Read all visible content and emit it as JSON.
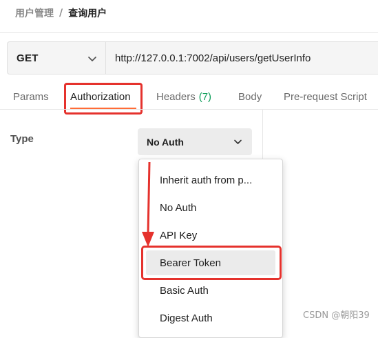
{
  "breadcrumb": {
    "parent": "用户管理",
    "separator": "/",
    "current": "查询用户"
  },
  "request": {
    "method": "GET",
    "url": "http://127.0.0.1:7002/api/users/getUserInfo"
  },
  "tabs": {
    "params": "Params",
    "authorization": "Authorization",
    "headers": "Headers",
    "headers_count": "(7)",
    "body": "Body",
    "prerequest": "Pre-request Script",
    "active": "Authorization"
  },
  "auth": {
    "type_label": "Type",
    "selected": "No Auth"
  },
  "dropdown": {
    "items": [
      "Inherit auth from p...",
      "No Auth",
      "API Key",
      "Bearer Token",
      "Basic Auth",
      "Digest Auth"
    ],
    "hovered": "Bearer Token"
  },
  "colors": {
    "annotation_red": "#e5322d",
    "active_tab_accent": "#ff6c37",
    "headers_count_green": "#0c9d58"
  },
  "icons": {
    "method_dropdown": "chevron-down-icon",
    "auth_dropdown": "chevron-down-icon"
  },
  "watermark": "CSDN @朝阳39"
}
